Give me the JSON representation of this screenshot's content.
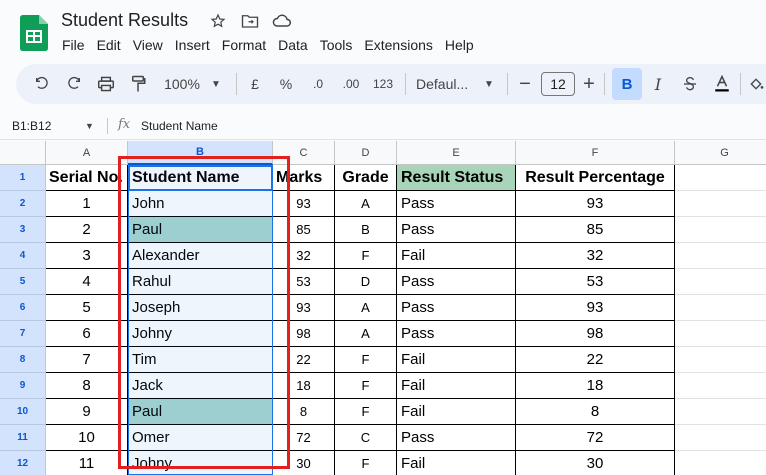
{
  "doc": {
    "title": "Student Results",
    "menu": [
      "File",
      "Edit",
      "View",
      "Insert",
      "Format",
      "Data",
      "Tools",
      "Extensions",
      "Help"
    ]
  },
  "toolbar": {
    "zoom": "100%",
    "currency": "£",
    "percent": "%",
    "dec_decrease": ".0",
    "dec_increase": ".00",
    "number_format": "123",
    "font": "Defaul...",
    "font_size": "12",
    "bold": "B",
    "italic": "I"
  },
  "formula_bar": {
    "name_box": "B1:B12",
    "fx": "fx",
    "formula": "Student  Name"
  },
  "grid": {
    "columns": [
      "A",
      "B",
      "C",
      "D",
      "E",
      "F",
      "G"
    ],
    "rows": [
      "1",
      "2",
      "3",
      "4",
      "5",
      "6",
      "7",
      "8",
      "9",
      "10",
      "11",
      "12"
    ],
    "headers": {
      "serial": "Serial No.",
      "name": "Student  Name",
      "marks": "Marks",
      "grade": "Grade",
      "status": "Result Status",
      "percentage": "Result Percentage"
    },
    "data": [
      {
        "serial": "1",
        "name": "John",
        "marks": "93",
        "grade": "A",
        "status": "Pass",
        "percentage": "93"
      },
      {
        "serial": "2",
        "name": "Paul",
        "marks": "85",
        "grade": "B",
        "status": "Pass",
        "percentage": "85"
      },
      {
        "serial": "3",
        "name": "Alexander",
        "marks": "32",
        "grade": "F",
        "status": "Fail",
        "percentage": "32"
      },
      {
        "serial": "4",
        "name": "Rahul",
        "marks": "53",
        "grade": "D",
        "status": "Pass",
        "percentage": "53"
      },
      {
        "serial": "5",
        "name": "Joseph",
        "marks": "93",
        "grade": "A",
        "status": "Pass",
        "percentage": "93"
      },
      {
        "serial": "6",
        "name": "Johny",
        "marks": "98",
        "grade": "A",
        "status": "Pass",
        "percentage": "98"
      },
      {
        "serial": "7",
        "name": "Tim",
        "marks": "22",
        "grade": "F",
        "status": "Fail",
        "percentage": "22"
      },
      {
        "serial": "8",
        "name": "Jack",
        "marks": "18",
        "grade": "F",
        "status": "Fail",
        "percentage": "18"
      },
      {
        "serial": "9",
        "name": "Paul",
        "marks": "8",
        "grade": "F",
        "status": "Fail",
        "percentage": "8"
      },
      {
        "serial": "10",
        "name": "Omer",
        "marks": "72",
        "grade": "C",
        "status": "Pass",
        "percentage": "72"
      },
      {
        "serial": "11",
        "name": "Johny",
        "marks": "30",
        "grade": "F",
        "status": "Fail",
        "percentage": "30"
      }
    ]
  },
  "colors": {
    "highlight_teal": "#a7d5cf",
    "status_header": "#a8d5b9",
    "selection_blue": "#1a73e8",
    "annotation_red": "#e32020"
  }
}
